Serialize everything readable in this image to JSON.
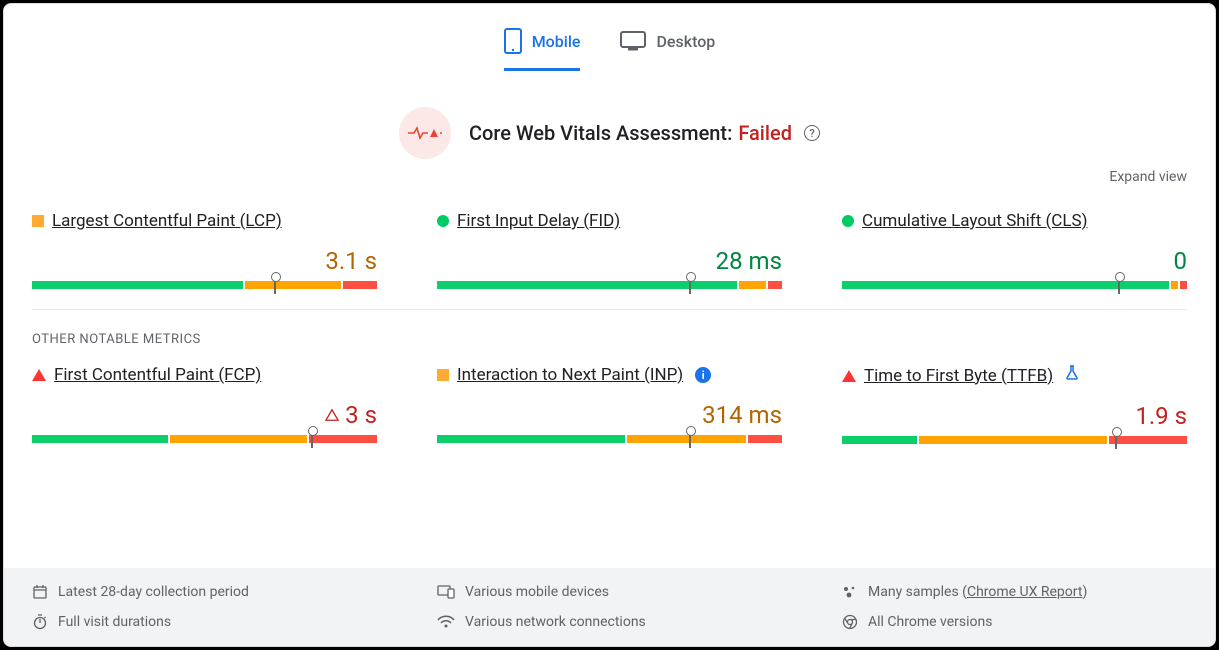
{
  "tabs": {
    "mobile": "Mobile",
    "desktop": "Desktop"
  },
  "assessment": {
    "label": "Core Web Vitals Assessment:",
    "status": "Failed"
  },
  "expand": "Expand view",
  "core_metrics": [
    {
      "name": "Largest Contentful Paint (LCP)",
      "status": "orange",
      "value": "3.1 s",
      "value_color": "orange",
      "segments": [
        62,
        28,
        10
      ],
      "marker": 70
    },
    {
      "name": "First Input Delay (FID)",
      "status": "green",
      "value": "28 ms",
      "value_color": "green",
      "segments": [
        88,
        8,
        4
      ],
      "marker": 73
    },
    {
      "name": "Cumulative Layout Shift (CLS)",
      "status": "green",
      "value": "0",
      "value_color": "green",
      "segments": [
        96,
        2,
        2
      ],
      "marker": 80
    }
  ],
  "section_label": "OTHER NOTABLE METRICS",
  "other_metrics": [
    {
      "name": "First Contentful Paint (FCP)",
      "status": "red",
      "value": "3 s",
      "value_color": "red",
      "prefix_warn": true,
      "segments": [
        40,
        40,
        20
      ],
      "marker": 81
    },
    {
      "name": "Interaction to Next Paint (INP)",
      "status": "orange",
      "info": true,
      "value": "314 ms",
      "value_color": "orange",
      "segments": [
        55,
        35,
        10
      ],
      "marker": 73
    },
    {
      "name": "Time to First Byte (TTFB)",
      "status": "red",
      "flask": true,
      "value": "1.9 s",
      "value_color": "red",
      "segments": [
        22,
        55,
        23
      ],
      "marker": 79
    }
  ],
  "footer": {
    "a": "Latest 28-day collection period",
    "b": "Various mobile devices",
    "c_pre": "Many samples (",
    "c_link": "Chrome UX Report",
    "c_post": ")",
    "d": "Full visit durations",
    "e": "Various network connections",
    "f": "All Chrome versions"
  }
}
